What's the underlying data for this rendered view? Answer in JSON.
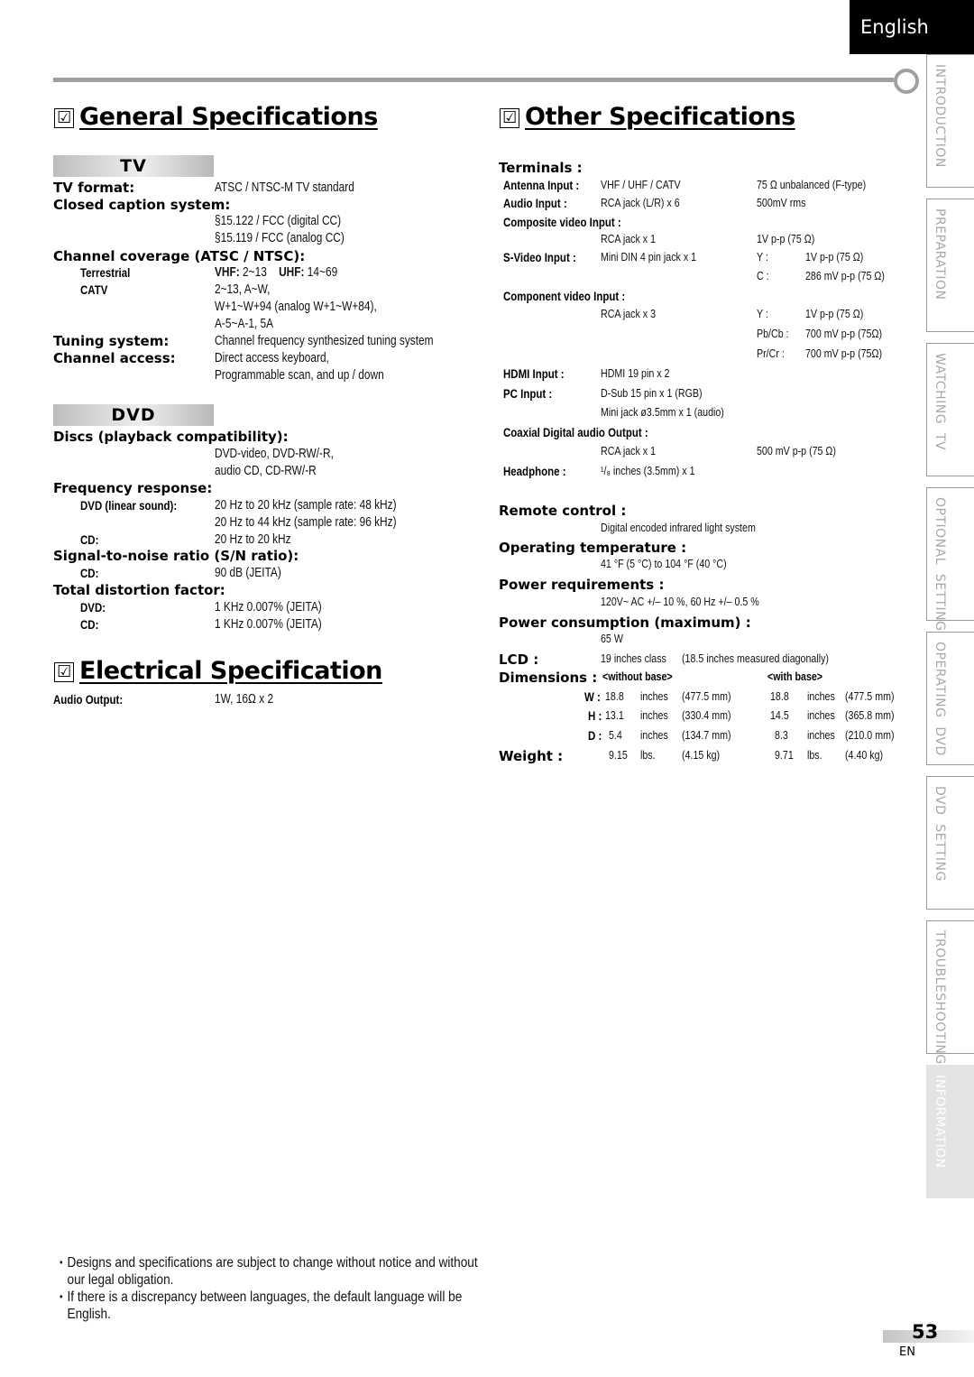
{
  "language_tab": "English",
  "side_tabs": [
    {
      "label": "INTRODUCTION",
      "active": false
    },
    {
      "label": "PREPARATION",
      "active": false
    },
    {
      "label": "WATCHING  TV",
      "active": false
    },
    {
      "label": "OPTIONAL  SETTING",
      "active": false
    },
    {
      "label": "OPERATING  DVD",
      "active": false
    },
    {
      "label": "DVD  SETTING",
      "active": false
    },
    {
      "label": "TROUBLESHOOTING",
      "active": false
    },
    {
      "label": "INFORMATION",
      "active": true
    }
  ],
  "checkbox_glyph": "☑",
  "general": {
    "title": "General Specifications",
    "tv_band": "TV",
    "tv_format_label": "TV format:",
    "tv_format_value": "ATSC / NTSC-M TV standard",
    "cc_label": "Closed caption system:",
    "cc_values": [
      "§15.122 / FCC (digital CC)",
      "§15.119 / FCC (analog CC)"
    ],
    "coverage_label": "Channel coverage (ATSC / NTSC):",
    "terrestrial_label": "Terrestrial",
    "vhf_label": "VHF:",
    "vhf_value": "2~13",
    "uhf_label": "UHF:",
    "uhf_value": "14~69",
    "catv_label": "CATV",
    "catv_values": [
      "2~13, A~W,",
      "W+1~W+94 (analog W+1~W+84),",
      "A-5~A-1, 5A"
    ],
    "tuning_label": "Tuning system:",
    "tuning_value": "Channel frequency synthesized tuning system",
    "access_label": "Channel access:",
    "access_values": [
      "Direct access keyboard,",
      "Programmable scan, and up / down"
    ],
    "dvd_band": "DVD",
    "discs_label": "Discs (playback compatibility):",
    "discs_values": [
      "DVD-video, DVD-RW/-R,",
      "audio CD, CD-RW/-R"
    ],
    "freq_label": "Frequency response:",
    "freq_dvd_label": "DVD (linear sound):",
    "freq_dvd_values": [
      "20 Hz to 20 kHz (sample rate: 48 kHz)",
      "20 Hz to 44 kHz (sample rate: 96 kHz)"
    ],
    "freq_cd_label": "CD:",
    "freq_cd_value": "20 Hz to 20 kHz",
    "snr_label": "Signal-to-noise ratio (S/N ratio):",
    "snr_cd_label": "CD:",
    "snr_cd_value": "90 dB (JEITA)",
    "tdf_label": "Total distortion factor:",
    "tdf_dvd_label": "DVD:",
    "tdf_dvd_value": "1 KHz  0.007% (JEITA)",
    "tdf_cd_label": "CD:",
    "tdf_cd_value": "1 KHz  0.007% (JEITA)"
  },
  "electrical": {
    "title": "Electrical Specification",
    "audio_output_label": "Audio Output:",
    "audio_output_value": "1W, 16Ω x 2"
  },
  "other": {
    "title": "Other Specifications",
    "terminals_label": "Terminals :",
    "antenna_label": "Antenna Input :",
    "antenna_value": "VHF / UHF / CATV",
    "antenna_spec": "75 Ω unbalanced (F-type)",
    "audio_in_label": "Audio Input :",
    "audio_in_value": "RCA jack (L/R) x 6",
    "audio_in_spec": "500mV rms",
    "composite_label": "Composite video Input :",
    "composite_value": "RCA jack x 1",
    "composite_spec": "1V p-p (75 Ω)",
    "svideo_label": "S-Video Input :",
    "svideo_value": "Mini DIN 4 pin jack x 1",
    "svideo_specs": [
      {
        "ch": "Y :",
        "spec": "1V p-p (75 Ω)"
      },
      {
        "ch": "C :",
        "spec": "286 mV p-p (75 Ω)"
      }
    ],
    "component_label": "Component video Input :",
    "component_value": "RCA jack x 3",
    "component_specs": [
      {
        "ch": "Y :",
        "spec": "1V p-p (75 Ω)"
      },
      {
        "ch": "Pb/Cb :",
        "spec": "700 mV p-p (75Ω)"
      },
      {
        "ch": "Pr/Cr :",
        "spec": "700 mV p-p (75Ω)"
      }
    ],
    "hdmi_label": "HDMI Input :",
    "hdmi_value": "HDMI 19 pin x 2",
    "pc_label": "PC Input :",
    "pc_values": [
      "D-Sub 15 pin x 1 (RGB)",
      "Mini jack ø3.5mm x 1 (audio)"
    ],
    "coax_label": "Coaxial Digital audio Output :",
    "coax_value": "RCA jack x 1",
    "coax_spec": "500 mV p-p (75 Ω)",
    "headphone_label": "Headphone :",
    "headphone_value": "¹/₈ inches (3.5mm) x 1",
    "remote_label": "Remote control :",
    "remote_value": "Digital encoded infrared light system",
    "optemp_label": "Operating temperature :",
    "optemp_value": "41 °F (5 °C) to 104 °F (40 °C)",
    "power_req_label": "Power requirements :",
    "power_req_value": "120V~ AC +/– 10 %, 60 Hz +/– 0.5 %",
    "power_cons_label": "Power consumption (maximum) :",
    "power_cons_value": "65 W",
    "lcd_label": "LCD :",
    "lcd_value": "19 inches class",
    "lcd_note": "(18.5 inches measured diagonally)",
    "dimensions_label": "Dimensions :",
    "without_base": "<without base>",
    "with_base": "<with base>",
    "dims": [
      {
        "axis": "W :",
        "v1": "18.8",
        "u1": "inches",
        "mm1": "(477.5 mm)",
        "v2": "18.8",
        "u2": "inches",
        "mm2": "(477.5 mm)"
      },
      {
        "axis": "H :",
        "v1": "13.1",
        "u1": "inches",
        "mm1": "(330.4 mm)",
        "v2": "14.5",
        "u2": "inches",
        "mm2": "(365.8 mm)"
      },
      {
        "axis": "D :",
        "v1": "5.4",
        "u1": "inches",
        "mm1": "(134.7 mm)",
        "v2": "8.3",
        "u2": "inches",
        "mm2": "(210.0 mm)"
      }
    ],
    "weight_label": "Weight :",
    "weight": {
      "v1": "9.15",
      "u1": "lbs.",
      "kg1": "(4.15 kg)",
      "v2": "9.71",
      "u2": "lbs.",
      "kg2": "(4.40 kg)"
    }
  },
  "notes": [
    "Designs and specifications are subject to change without notice and without our legal obligation.",
    "If there is a discrepancy between languages, the default language will be English."
  ],
  "page_number": "53",
  "page_lang": "EN"
}
